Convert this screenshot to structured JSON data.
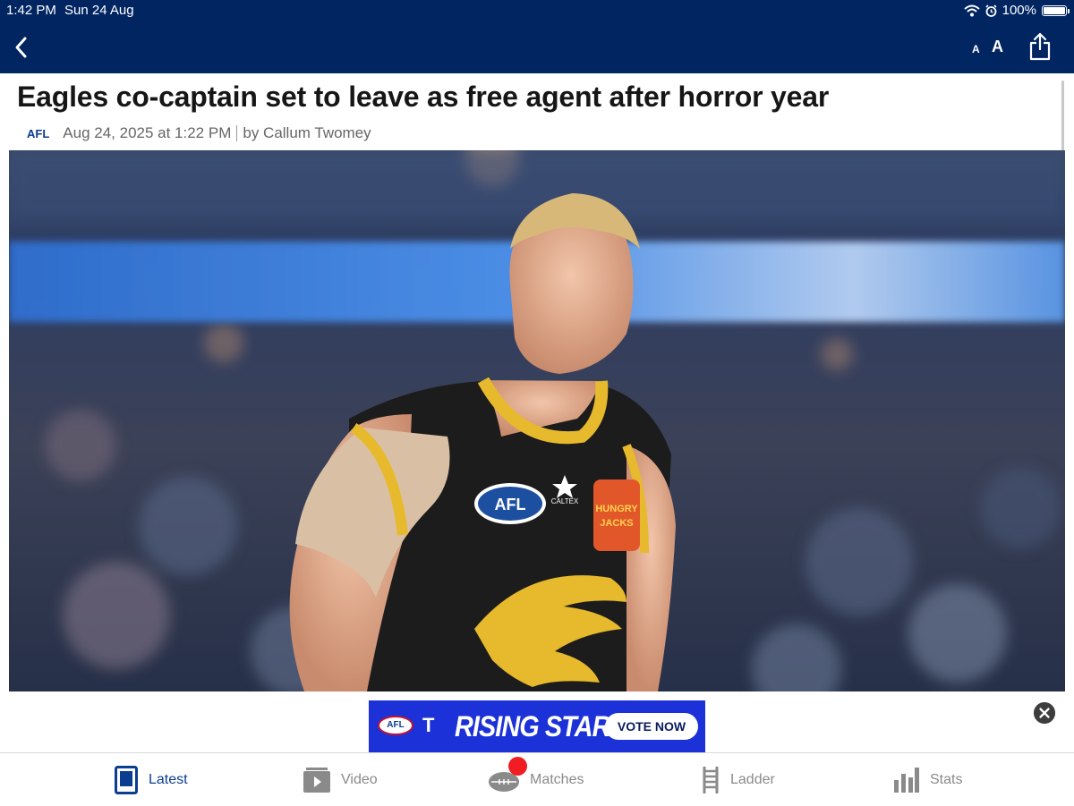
{
  "status_bar": {
    "time": "1:42 PM",
    "date": "Sun 24 Aug",
    "battery": "100%"
  },
  "nav": {
    "font_small": "A",
    "font_large": "A",
    "icons": [
      "chevron-left-icon",
      "share-icon"
    ]
  },
  "article": {
    "headline": "Eagles co-captain set to leave as free agent after horror year",
    "tag": "AFL",
    "date": "Aug 24, 2025 at 1:22 PM",
    "author": "by Callum Twomey",
    "photo_jersey": {
      "logo": "AFL",
      "sponsor_1": "CALTEX",
      "sponsor_2a": "HUNGRY",
      "sponsor_2b": "JACKS"
    }
  },
  "ad": {
    "logo": "AFL",
    "t_mark": "T",
    "title": "RISING STAR",
    "cta": "VOTE NOW"
  },
  "tabs": [
    {
      "label": "Latest",
      "icon": "news-icon"
    },
    {
      "label": "Video",
      "icon": "play-icon"
    },
    {
      "label": "Matches",
      "icon": "football-icon"
    },
    {
      "label": "Ladder",
      "icon": "ladder-icon"
    },
    {
      "label": "Stats",
      "icon": "bar-chart-icon"
    }
  ],
  "colors": {
    "header": "#012561",
    "accent": "#0b3d91",
    "inactive": "#8a8a8a",
    "badge": "#f01d23",
    "ad": "#1c32d8"
  }
}
